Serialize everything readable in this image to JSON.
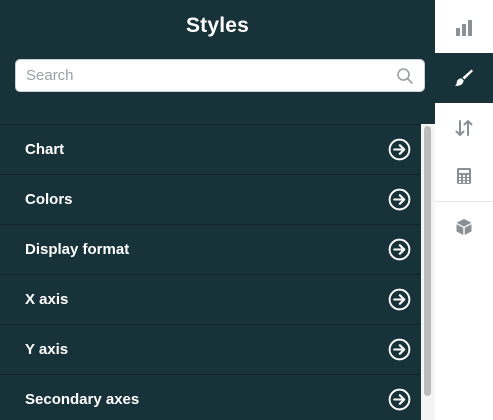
{
  "panel": {
    "title": "Styles",
    "search": {
      "placeholder": "Search",
      "value": ""
    },
    "items": [
      {
        "label": "Chart"
      },
      {
        "label": "Colors"
      },
      {
        "label": "Display format"
      },
      {
        "label": "X axis"
      },
      {
        "label": "Y axis"
      },
      {
        "label": "Secondary axes"
      }
    ]
  },
  "rail": {
    "items": [
      {
        "icon": "bar-chart-icon",
        "active": false
      },
      {
        "icon": "paintbrush-icon",
        "active": true
      },
      {
        "icon": "sort-arrows-icon",
        "active": false
      },
      {
        "icon": "calculator-icon",
        "active": false
      },
      {
        "icon": "cube-icon",
        "active": false
      }
    ]
  },
  "colors": {
    "panel_bg": "#173339",
    "text": "#ffffff",
    "icon_gray": "#8a9093"
  }
}
